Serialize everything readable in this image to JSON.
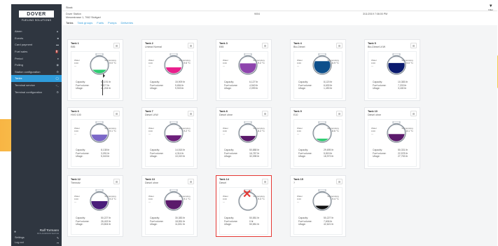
{
  "branding": {
    "name": "DOVER",
    "subtitle": "FUELING SOLUTIONS"
  },
  "sidebar": {
    "items": [
      {
        "label": "Alarm",
        "icon": "bell-icon",
        "glyph": "▲"
      },
      {
        "label": "Events",
        "icon": "list-icon",
        "glyph": "■"
      },
      {
        "label": "Card payment",
        "icon": "card-icon",
        "glyph": "▬"
      },
      {
        "label": "Fuel sales",
        "icon": "fuel-icon",
        "glyph": "⛽"
      },
      {
        "label": "Period",
        "icon": "period-icon",
        "glyph": "●"
      },
      {
        "label": "Polling",
        "icon": "polling-icon",
        "glyph": "◉"
      },
      {
        "label": "Station configuration",
        "icon": "sliders-icon",
        "glyph": "⚙"
      },
      {
        "label": "Tanks",
        "icon": "tank-icon",
        "glyph": "◯",
        "active": true
      },
      {
        "label": "Terminal service",
        "icon": "terminal-icon",
        "glyph": ">_"
      },
      {
        "label": "Terminal configuration",
        "icon": "settings-icon",
        "glyph": "⚙"
      }
    ],
    "user": {
      "name": "Ralf Tormann",
      "role": "DFS ADMINISTRATOR"
    },
    "settings_label": "Settings",
    "logout_label": "Log out"
  },
  "topbar": {
    "title": "Stock",
    "filter_label": "Filter"
  },
  "info": {
    "station_name": "Dover Station",
    "address": "Messestrasse 1, 7062 Stuttgart",
    "station_id": "9004",
    "timestamp": "3/11/2019 7:08:00 PM"
  },
  "tabs": [
    "Tanks",
    "Tank groups",
    "Fuels",
    "Pumps",
    "Deliveries"
  ],
  "labels": {
    "water": "Water",
    "temperature": "Temperature",
    "capacity": "Capacity:",
    "fuel_volume": "Fuel volume:",
    "ullage": "Ullage:"
  },
  "tanks": [
    {
      "title": "Tank 1",
      "product": "E85",
      "water": "0.00",
      "temperature": "9.0 °C",
      "capacity": "50,191 ltr",
      "fuel_volume": "9,0?? ltr",
      "ullage": "41,204 ltr",
      "fill": 0.25,
      "color": "#2ecc71"
    },
    {
      "title": "Tank 2",
      "product": "Unlead Normal",
      "water": "0.00",
      "temperature": "9.6 °C",
      "capacity": "15,909 ltr",
      "fuel_volume": "5,654 ltr",
      "ullage": "9,903 ltr",
      "fill": 0.38,
      "color": "#e91e8c"
    },
    {
      "title": "Tank 3",
      "product": "E85",
      "water": "0.00",
      "temperature": "9.2 °C",
      "capacity": "6,127 ltr",
      "fuel_volume": "4,540 ltr",
      "ullage": "2,099 ltr",
      "fill": 0.6,
      "color": "#8e44ad"
    },
    {
      "title": "Tank 4",
      "product": "Bio-Diesel",
      "water": "0.00",
      "temperature": "6.9 °C",
      "capacity": "8,120 ltr",
      "fuel_volume": "6,630 ltr",
      "ullage": "1,490 ltr",
      "fill": 0.72,
      "color": "#0d4f8b"
    },
    {
      "title": "Tank 5",
      "product": "Bio-Diesel LKW",
      "water": "0.00",
      "temperature": "9.0 °C",
      "capacity": "10,383 ltr",
      "fuel_volume": "7,203 ltr",
      "ullage": "3,180 ltr",
      "fill": 0.62,
      "color": "#0a1a6e"
    },
    {
      "title": "Tank 6",
      "product": "HVO 100",
      "water": "0.00",
      "temperature": "9.1 °C",
      "capacity": "8,138 ltr",
      "fuel_volume": "3,091 ltr",
      "ullage": "5,043 ltr",
      "fill": 0.42,
      "color": "#7b68c8"
    },
    {
      "title": "Tank 7",
      "product": "Diesel LKW",
      "water": "0.00",
      "temperature": "9.2 °C",
      "capacity": "14,518 ltr",
      "fuel_volume": "4,314 ltr",
      "ullage": "10,019 ltr",
      "fill": 0.38,
      "color": "#6c1f7a"
    },
    {
      "title": "Tank 8",
      "product": "Diesel ohne",
      "water": "0.00",
      "temperature": "8.2 °C",
      "capacity": "50,888 ltr",
      "fuel_volume": "16,787 ltr",
      "ullage": "32,098 ltr",
      "fill": 0.35,
      "color": "#5b1a6b"
    },
    {
      "title": "Tank 9",
      "product": "E10",
      "water": "0.00",
      "temperature": "8.6 °C",
      "capacity": "29,695 ltr",
      "fuel_volume": "5,815 ltr",
      "ullage": "18,973 ltr",
      "fill": 0.2,
      "color": "#2ecc71"
    },
    {
      "title": "Tank 10",
      "product": "Diesel ohne",
      "water": "0.00",
      "temperature": "8.1 °C",
      "capacity": "50,331 ltr",
      "fuel_volume": "22,578 ltr",
      "ullage": "27,753 ltr",
      "fill": 0.45,
      "color": "#5b1a6b"
    },
    {
      "title": "Tank 12",
      "product": "Tiremotz",
      "water": "0.00",
      "temperature": "9.3 °C",
      "capacity": "50,227 ltr",
      "fuel_volume": "26,402 ltr",
      "ullage": "23,804 ltr",
      "fill": 0.5,
      "color": "#4a1d7a"
    },
    {
      "title": "Tank 13",
      "product": "Diesel ohne",
      "water": "0.00",
      "temperature": "9.1 °C",
      "capacity": "30,383 ltr",
      "fuel_volume": "18,551 ltr",
      "ullage": "11,831 ltr",
      "fill": 0.55,
      "color": "#5b1a6b"
    },
    {
      "title": "Tank 14",
      "product": "Diesel",
      "water": "0.00",
      "temperature": "9.3 °C",
      "capacity": "50,581 ltr",
      "fuel_volume": "0 ltr",
      "ullage": "50,581 ltr",
      "fill": 0.0,
      "color": "#ffffff",
      "alert": true
    },
    {
      "title": "Tank 15",
      "product": "?",
      "water": "0.00",
      "temperature": "9.4 °C",
      "capacity": "50,227 ltr",
      "fuel_volume": "7,606 ltr",
      "ullage": "42,621 ltr",
      "fill": 0.25,
      "color": "#111111"
    }
  ]
}
